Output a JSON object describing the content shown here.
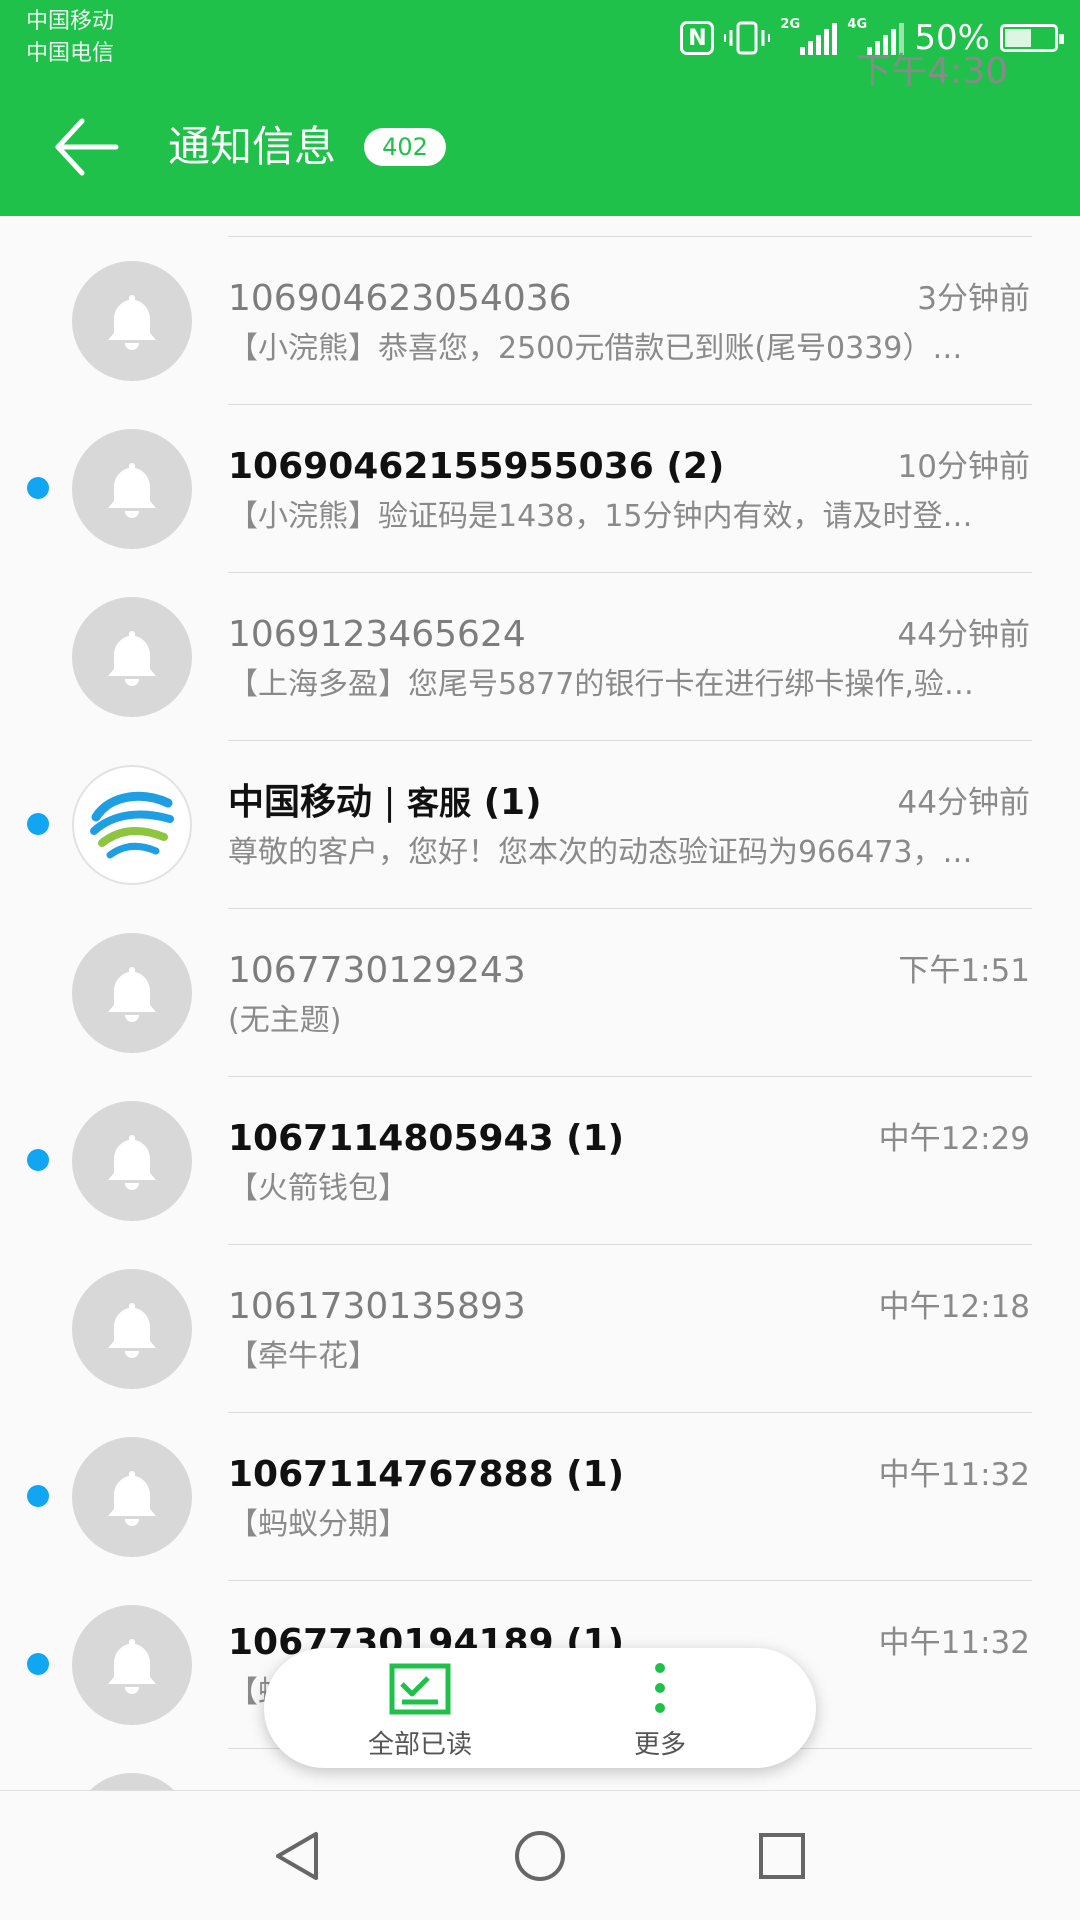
{
  "status_bar": {
    "carriers": [
      "中国移动",
      "中国电信"
    ],
    "battery_percent": "50%",
    "battery_level": 0.5,
    "time": "下午4:30",
    "nfc_label": "N",
    "signal_1_tag": "2G",
    "signal_2_tag": "4G",
    "icons": [
      "nfc-icon",
      "vibrate-icon",
      "signal-2g-icon",
      "signal-4g-icon",
      "battery-icon"
    ]
  },
  "header": {
    "title": "通知信息",
    "count": "402",
    "back_icon": "arrow-back-icon",
    "background_color": "#1fc14a"
  },
  "messages": [
    {
      "sender": "106904623054036",
      "time": "3分钟前",
      "snippet": "【小浣熊】恭喜您，2500元借款已到账(尾号0339）…",
      "unread": false,
      "avatar": "bell-icon"
    },
    {
      "sender": "10690462155955036 (2)",
      "time": "10分钟前",
      "snippet": "【小浣熊】验证码是1438，15分钟内有效，请及时登…",
      "unread": true,
      "avatar": "bell-icon"
    },
    {
      "sender": "1069123465624",
      "time": "44分钟前",
      "snippet": "【上海多盈】您尾号5877的银行卡在进行绑卡操作,验…",
      "unread": false,
      "avatar": "bell-icon"
    },
    {
      "sender_main": "中国移动",
      "sender_sep": " | ",
      "sender_sub": "客服",
      "sender_count": " (1)",
      "time": "44分钟前",
      "snippet": "尊敬的客户，您好！您本次的动态验证码为966473，…",
      "unread": true,
      "avatar": "china-mobile-logo"
    },
    {
      "sender": "1067730129243",
      "time": "下午1:51",
      "snippet": "(无主题)",
      "unread": false,
      "avatar": "bell-icon"
    },
    {
      "sender": "1067114805943 (1)",
      "time": "中午12:29",
      "snippet": "【火箭钱包】",
      "unread": true,
      "avatar": "bell-icon"
    },
    {
      "sender": "1061730135893",
      "time": "中午12:18",
      "snippet": "【牵牛花】",
      "unread": false,
      "avatar": "bell-icon"
    },
    {
      "sender": "1067114767888 (1)",
      "time": "中午11:32",
      "snippet": "【蚂蚁分期】",
      "unread": true,
      "avatar": "bell-icon"
    },
    {
      "sender": "1067730194189 (1)",
      "time": "中午11:32",
      "snippet": "【蚂蚁分期】",
      "unread": true,
      "avatar": "bell-icon"
    }
  ],
  "action_bar": {
    "mark_all_read": {
      "label": "全部已读",
      "icon": "mark-read-icon"
    },
    "more": {
      "label": "更多",
      "icon": "more-vertical-icon"
    }
  },
  "nav_bar": {
    "buttons": [
      "back-triangle-icon",
      "home-circle-icon",
      "recents-square-icon"
    ]
  },
  "colors": {
    "accent": "#1fc14a",
    "unread_dot": "#11a6f3",
    "avatar_bg": "#d8d8d8"
  }
}
